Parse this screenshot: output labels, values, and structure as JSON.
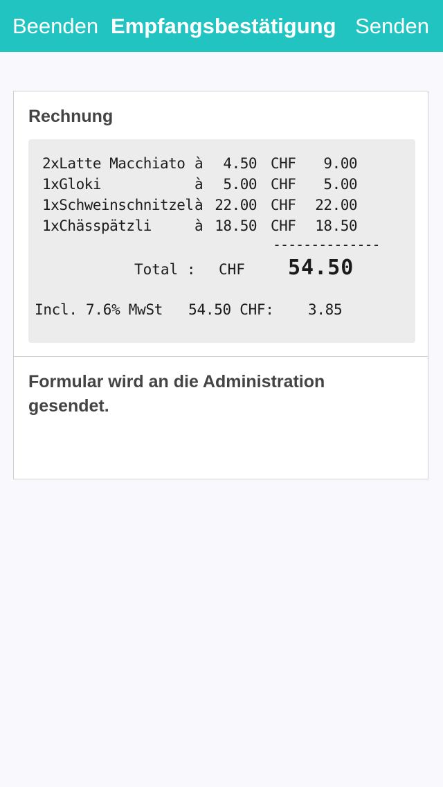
{
  "navbar": {
    "left_label": "Beenden",
    "title": "Empfangsbestätigung",
    "right_label": "Senden",
    "background_color": "#21c4c0"
  },
  "card": {
    "heading": "Rechnung",
    "receipt": {
      "items": [
        {
          "name": "2xLatte Macchiato",
          "at": "à",
          "price": "4.50",
          "currency": "CHF",
          "amount": "9.00"
        },
        {
          "name": "1xGloki",
          "at": "à",
          "price": "5.00",
          "currency": "CHF",
          "amount": "5.00"
        },
        {
          "name": "1xSchweinschnitzel",
          "at": "à",
          "price": "22.00",
          "currency": "CHF",
          "amount": "22.00"
        },
        {
          "name": "1xChässpätzli",
          "at": "à",
          "price": "18.50",
          "currency": "CHF",
          "amount": "18.50"
        }
      ],
      "separator": "--------------",
      "total_label": "Total :",
      "total_currency": "CHF",
      "total_value": "54.50",
      "vat_line": "Incl. 7.6% MwSt   54.50 CHF:    3.85"
    },
    "message": "Formular wird an die Administration gesendet."
  }
}
